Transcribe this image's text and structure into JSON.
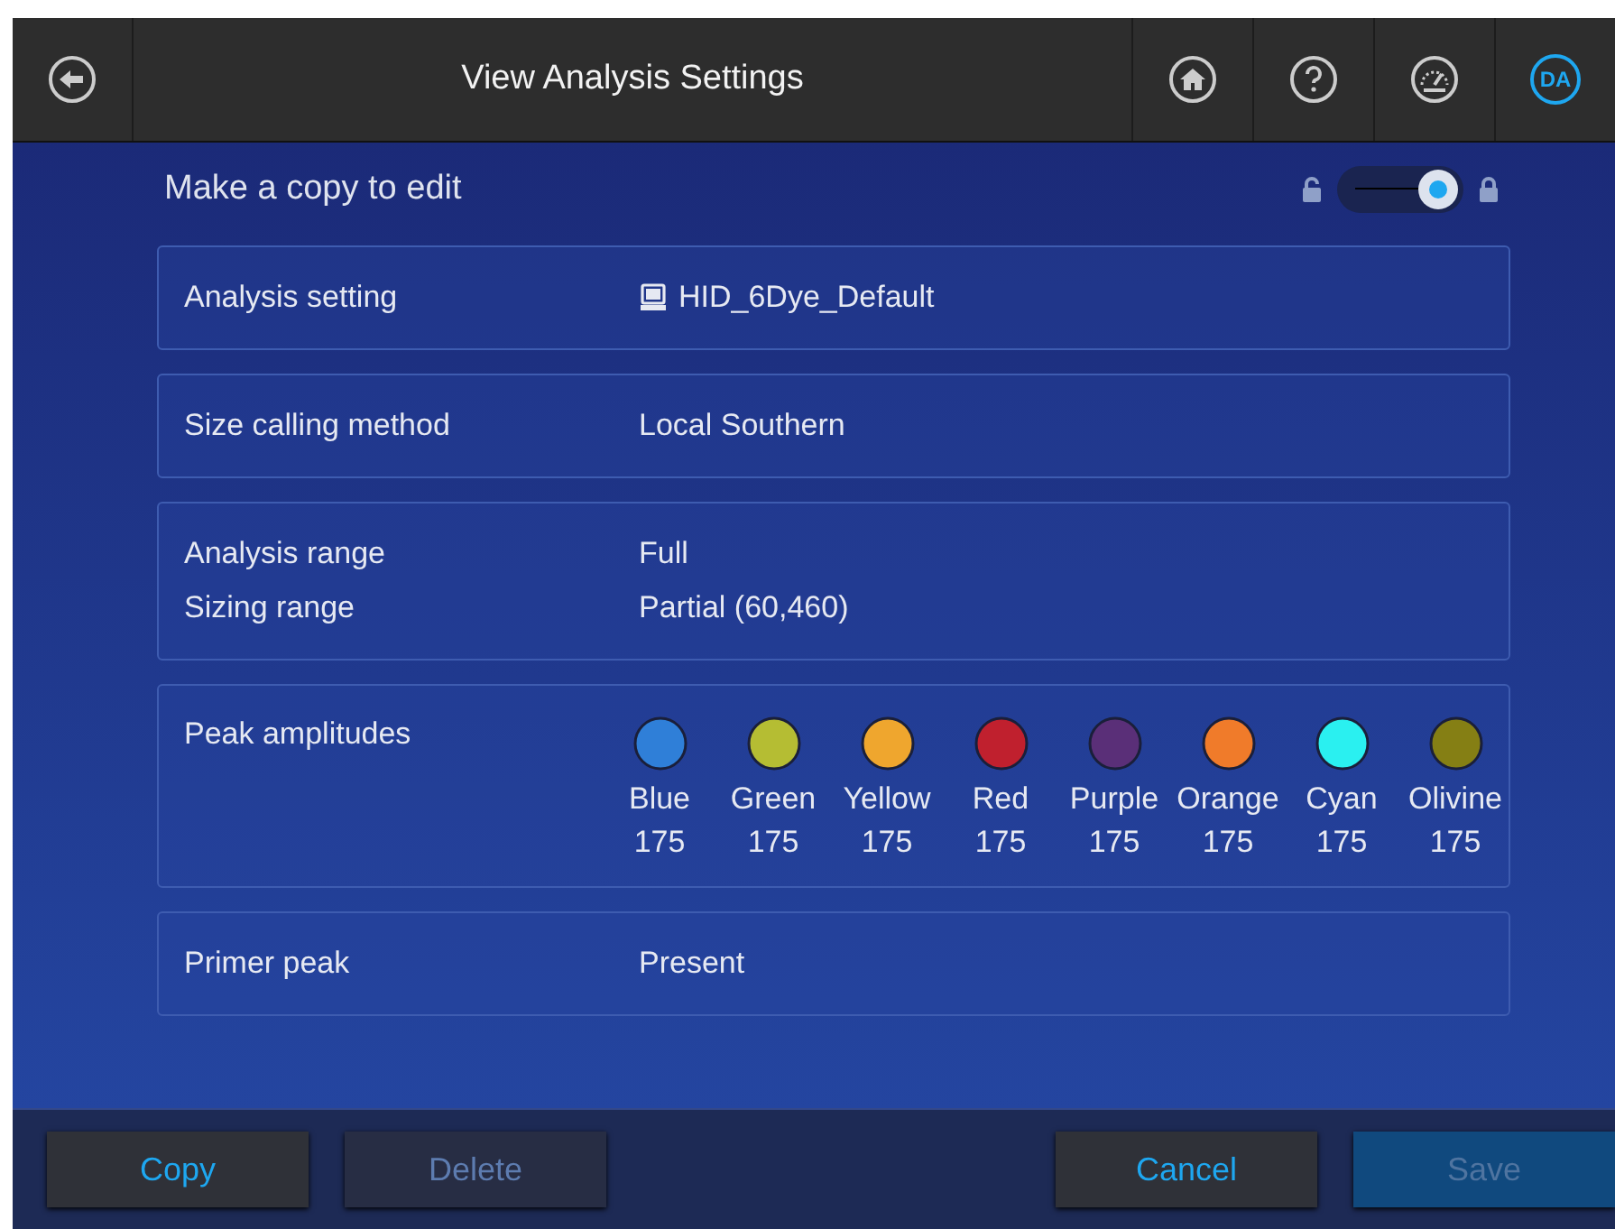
{
  "header": {
    "title": "View Analysis Settings",
    "user_initials": "DA"
  },
  "copy_toggle": {
    "label": "Make a copy to edit",
    "on": true
  },
  "sections": [
    {
      "kind": "pairs",
      "rows": [
        {
          "label": "Analysis setting",
          "value": "HID_6Dye_Default",
          "icon": true
        }
      ]
    },
    {
      "kind": "pairs",
      "rows": [
        {
          "label": "Size calling method",
          "value": "Local Southern"
        }
      ]
    },
    {
      "kind": "pairs",
      "rows": [
        {
          "label": "Analysis range",
          "value": "Full"
        },
        {
          "label": "Sizing range",
          "value": "Partial (60,460)"
        }
      ]
    },
    {
      "kind": "dyes",
      "label": "Peak amplitudes",
      "dyes": [
        {
          "name": "Blue",
          "value": "175",
          "color": "#2f7fd8"
        },
        {
          "name": "Green",
          "value": "175",
          "color": "#b5bd33"
        },
        {
          "name": "Yellow",
          "value": "175",
          "color": "#efa62e"
        },
        {
          "name": "Red",
          "value": "175",
          "color": "#c0202e"
        },
        {
          "name": "Purple",
          "value": "175",
          "color": "#5a2f78"
        },
        {
          "name": "Orange",
          "value": "175",
          "color": "#f07b2a"
        },
        {
          "name": "Cyan",
          "value": "175",
          "color": "#2af0f0"
        },
        {
          "name": "Olivine",
          "value": "175",
          "color": "#857f14"
        }
      ]
    },
    {
      "kind": "pairs",
      "rows": [
        {
          "label": "Primer peak",
          "value": "Present"
        }
      ]
    }
  ],
  "footer": {
    "left": [
      {
        "label": "Copy",
        "disabled": false
      },
      {
        "label": "Delete",
        "disabled": true
      }
    ],
    "right": [
      {
        "label": "Cancel",
        "disabled": false
      },
      {
        "label": "Save",
        "disabled": true
      }
    ]
  }
}
